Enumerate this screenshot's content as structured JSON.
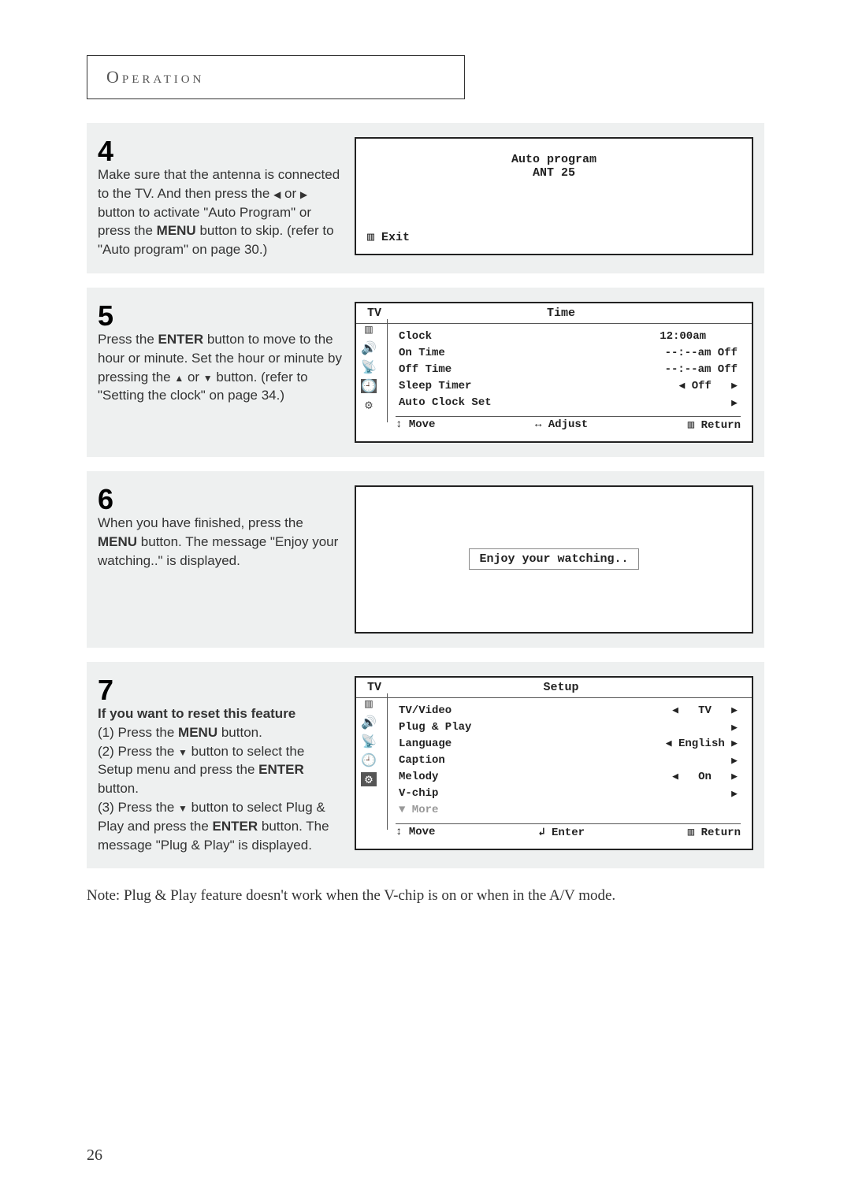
{
  "section_title": "Operation",
  "step4": {
    "num": "4",
    "text_1": "Make sure that the antenna is connected to the TV. And then press the ",
    "text_2": " or ",
    "text_3": " button to activate \"Auto Program\" or press the ",
    "menu_label": "MENU",
    "text_4": " button to skip. (refer to \"Auto program\" on page 30.)",
    "osd_title": "Auto program",
    "osd_line": "ANT   25",
    "osd_exit": "Exit"
  },
  "step5": {
    "num": "5",
    "text_1": "Press the ",
    "enter_label": "ENTER",
    "text_2": " button to move to the hour or minute.  Set the hour or minute by pressing the ",
    "text_3": " or ",
    "text_4": " button. (refer to \"Setting the clock\" on page 34.)",
    "osd_tv": "TV",
    "osd_title": "Time",
    "rows": [
      {
        "label": "Clock",
        "value": "12:00am"
      },
      {
        "label": "On Time",
        "value": "--:--am Off"
      },
      {
        "label": "Off Time",
        "value": "--:--am Off"
      },
      {
        "label": "Sleep Timer",
        "prefix": "◀",
        "value": "Off",
        "suffix": "▶"
      },
      {
        "label": "Auto Clock Set",
        "suffix": "▶"
      }
    ],
    "footer": {
      "move": "Move",
      "adjust": "Adjust",
      "return": "Return"
    }
  },
  "step6": {
    "num": "6",
    "text_1": "When you have finished, press the ",
    "menu_label": "MENU",
    "text_2": " button. The message \"Enjoy your watching..\" is displayed.",
    "osd_msg": "Enjoy your watching.."
  },
  "step7": {
    "num": "7",
    "heading": "If you want to reset this feature",
    "line1a": "(1) Press the ",
    "menu_label": "MENU",
    "line1b": " button.",
    "line2a": "(2) Press the ",
    "line2b": " button to select the Setup menu and press the ",
    "enter_label": "ENTER",
    "line2c": " button.",
    "line3a": "(3) Press the ",
    "line3b": " button to select Plug & Play and press the ",
    "line3c": " button. The message \"Plug & Play\" is displayed.",
    "osd_tv": "TV",
    "osd_title": "Setup",
    "rows": [
      {
        "label": "TV/Video",
        "prefix": "◀",
        "value": "TV",
        "suffix": "▶"
      },
      {
        "label": "Plug & Play",
        "suffix": "▶"
      },
      {
        "label": "Language",
        "prefix": "◀",
        "value": "English",
        "suffix": "▶"
      },
      {
        "label": "Caption",
        "suffix": "▶"
      },
      {
        "label": "Melody",
        "prefix": "◀",
        "value": "On",
        "suffix": "▶"
      },
      {
        "label": "V-chip",
        "suffix": "▶"
      },
      {
        "label": "▼ More",
        "grey": true
      }
    ],
    "footer": {
      "move": "Move",
      "enter": "Enter",
      "return": "Return"
    }
  },
  "note_text": "Note: Plug & Play feature doesn't work when the V-chip is on or when in the A/V mode.",
  "page_number": "26",
  "icons": {
    "picture": "▥",
    "sound": "🔊",
    "channel": "📡",
    "time": "🕘",
    "setup": "⚙",
    "menu_square": "▥",
    "updown": "↕",
    "leftright": "↔",
    "enter_sym": "↲"
  }
}
